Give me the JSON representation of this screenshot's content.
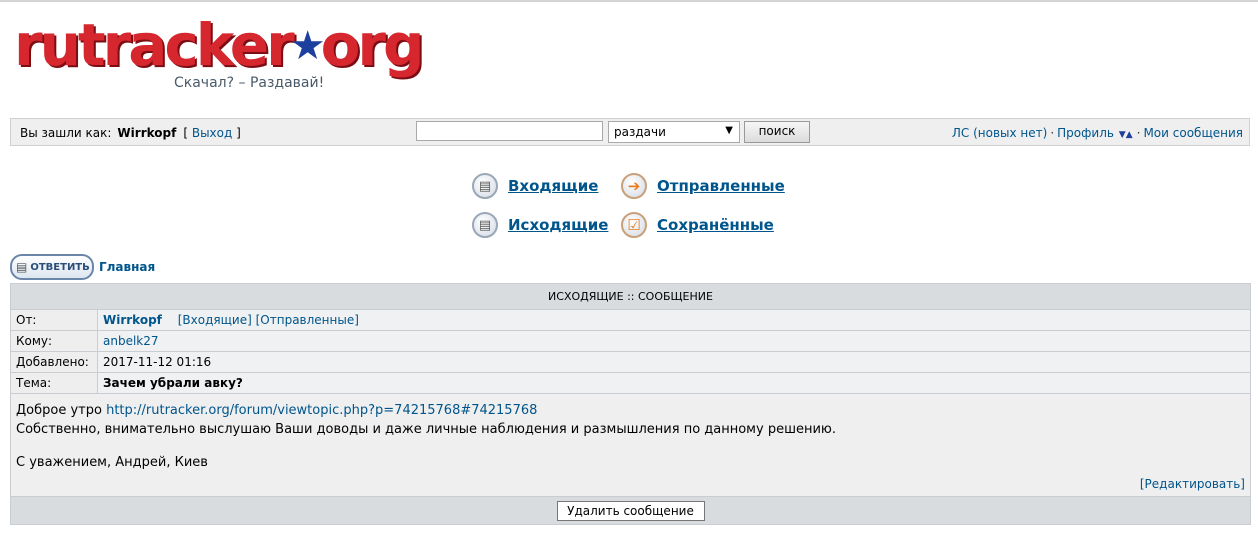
{
  "logo": {
    "main_ru": "rutracker",
    "star": "★",
    "main_org": "org",
    "slogan": "Скачал? – Раздавай!"
  },
  "topbar": {
    "login_label": "Вы зашли как:",
    "username": "Wirrkopf",
    "logout_open": "[",
    "logout_label": "Выход",
    "logout_close": "]",
    "search_value": "",
    "search_placeholder": "",
    "search_scope": "раздачи",
    "search_button": "поиск",
    "pm_link": "ЛС (новых нет)",
    "profile_link": "Профиль",
    "my_messages_link": "Мои сообщения"
  },
  "folders": {
    "inbox": "Входящие",
    "sent": "Отправленные",
    "outbox": "Исходящие",
    "saved": "Сохранённые"
  },
  "breadcrumb": {
    "reply_label": "ОТВЕТИТЬ",
    "home": "Главная"
  },
  "message": {
    "header": "ИСХОДЯЩИЕ :: СООБЩЕНИЕ",
    "from_label": "От:",
    "from_user": "Wirrkopf",
    "from_inbox_link": "[Входящие]",
    "from_sent_link": "[Отправленные]",
    "to_label": "Кому:",
    "to_user": "anbelk27",
    "added_label": "Добавлено:",
    "added_value": "2017-11-12 01:16",
    "subject_label": "Тема:",
    "subject_value": "Зачем убрали авку?",
    "body_greeting": "Доброе утро",
    "body_link": "http://rutracker.org/forum/viewtopic.php?p=74215768#74215768",
    "body_line2": "Собственно, внимательно выслушаю Ваши доводы и даже личные наблюдения и размышления по данному решению.",
    "body_signature": "С уважением, Андрей, Киев",
    "edit_link": "[Редактировать]",
    "delete_button": "Удалить сообщение"
  }
}
